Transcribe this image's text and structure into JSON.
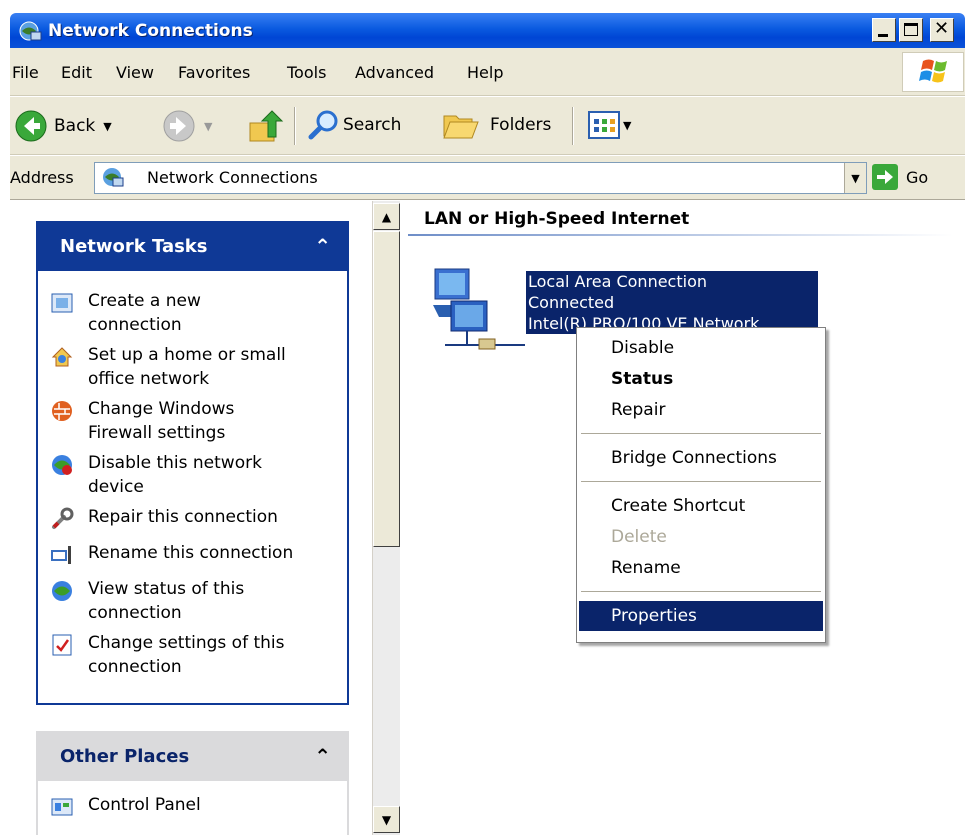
{
  "window": {
    "title": "Network Connections"
  },
  "menu": [
    "File",
    "Edit",
    "View",
    "Favorites",
    "Tools",
    "Advanced",
    "Help"
  ],
  "toolbar": {
    "back": "Back",
    "search": "Search",
    "folders": "Folders"
  },
  "address": {
    "label": "Address",
    "value": "Network Connections",
    "go": "Go"
  },
  "network_tasks": {
    "title": "Network Tasks",
    "items": [
      {
        "icon": "new-connection-icon",
        "label": "Create a new connection"
      },
      {
        "icon": "home-network-icon",
        "label": "Set up a home or small office network"
      },
      {
        "icon": "firewall-icon",
        "label": "Change Windows Firewall settings"
      },
      {
        "icon": "disable-network-icon",
        "label": "Disable this network device"
      },
      {
        "icon": "repair-icon",
        "label": "Repair this connection"
      },
      {
        "icon": "rename-icon",
        "label": "Rename this connection"
      },
      {
        "icon": "status-icon",
        "label": "View status of this connection"
      },
      {
        "icon": "settings-icon",
        "label": "Change settings of this connection"
      }
    ]
  },
  "other_places": {
    "title": "Other Places",
    "items": [
      {
        "icon": "control-panel-icon",
        "label": "Control Panel"
      }
    ]
  },
  "main": {
    "section": "LAN or High-Speed Internet",
    "connection": {
      "name": "Local Area Connection",
      "status": "Connected",
      "device": "Intel(R) PRO/100 VE Network..."
    }
  },
  "context_menu": {
    "items": [
      {
        "label": "Disable",
        "style": "normal"
      },
      {
        "label": "Status",
        "style": "bold"
      },
      {
        "label": "Repair",
        "style": "normal"
      },
      {
        "label": "Bridge Connections",
        "style": "normal"
      },
      {
        "label": "Create Shortcut",
        "style": "normal"
      },
      {
        "label": "Delete",
        "style": "disabled"
      },
      {
        "label": "Rename",
        "style": "normal"
      },
      {
        "label": "Properties",
        "style": "selected"
      }
    ]
  },
  "colors": {
    "titlebar": "#0a5ae0",
    "task_header": "#0f3996",
    "selection": "#0a246a",
    "chrome": "#ece9d8"
  }
}
